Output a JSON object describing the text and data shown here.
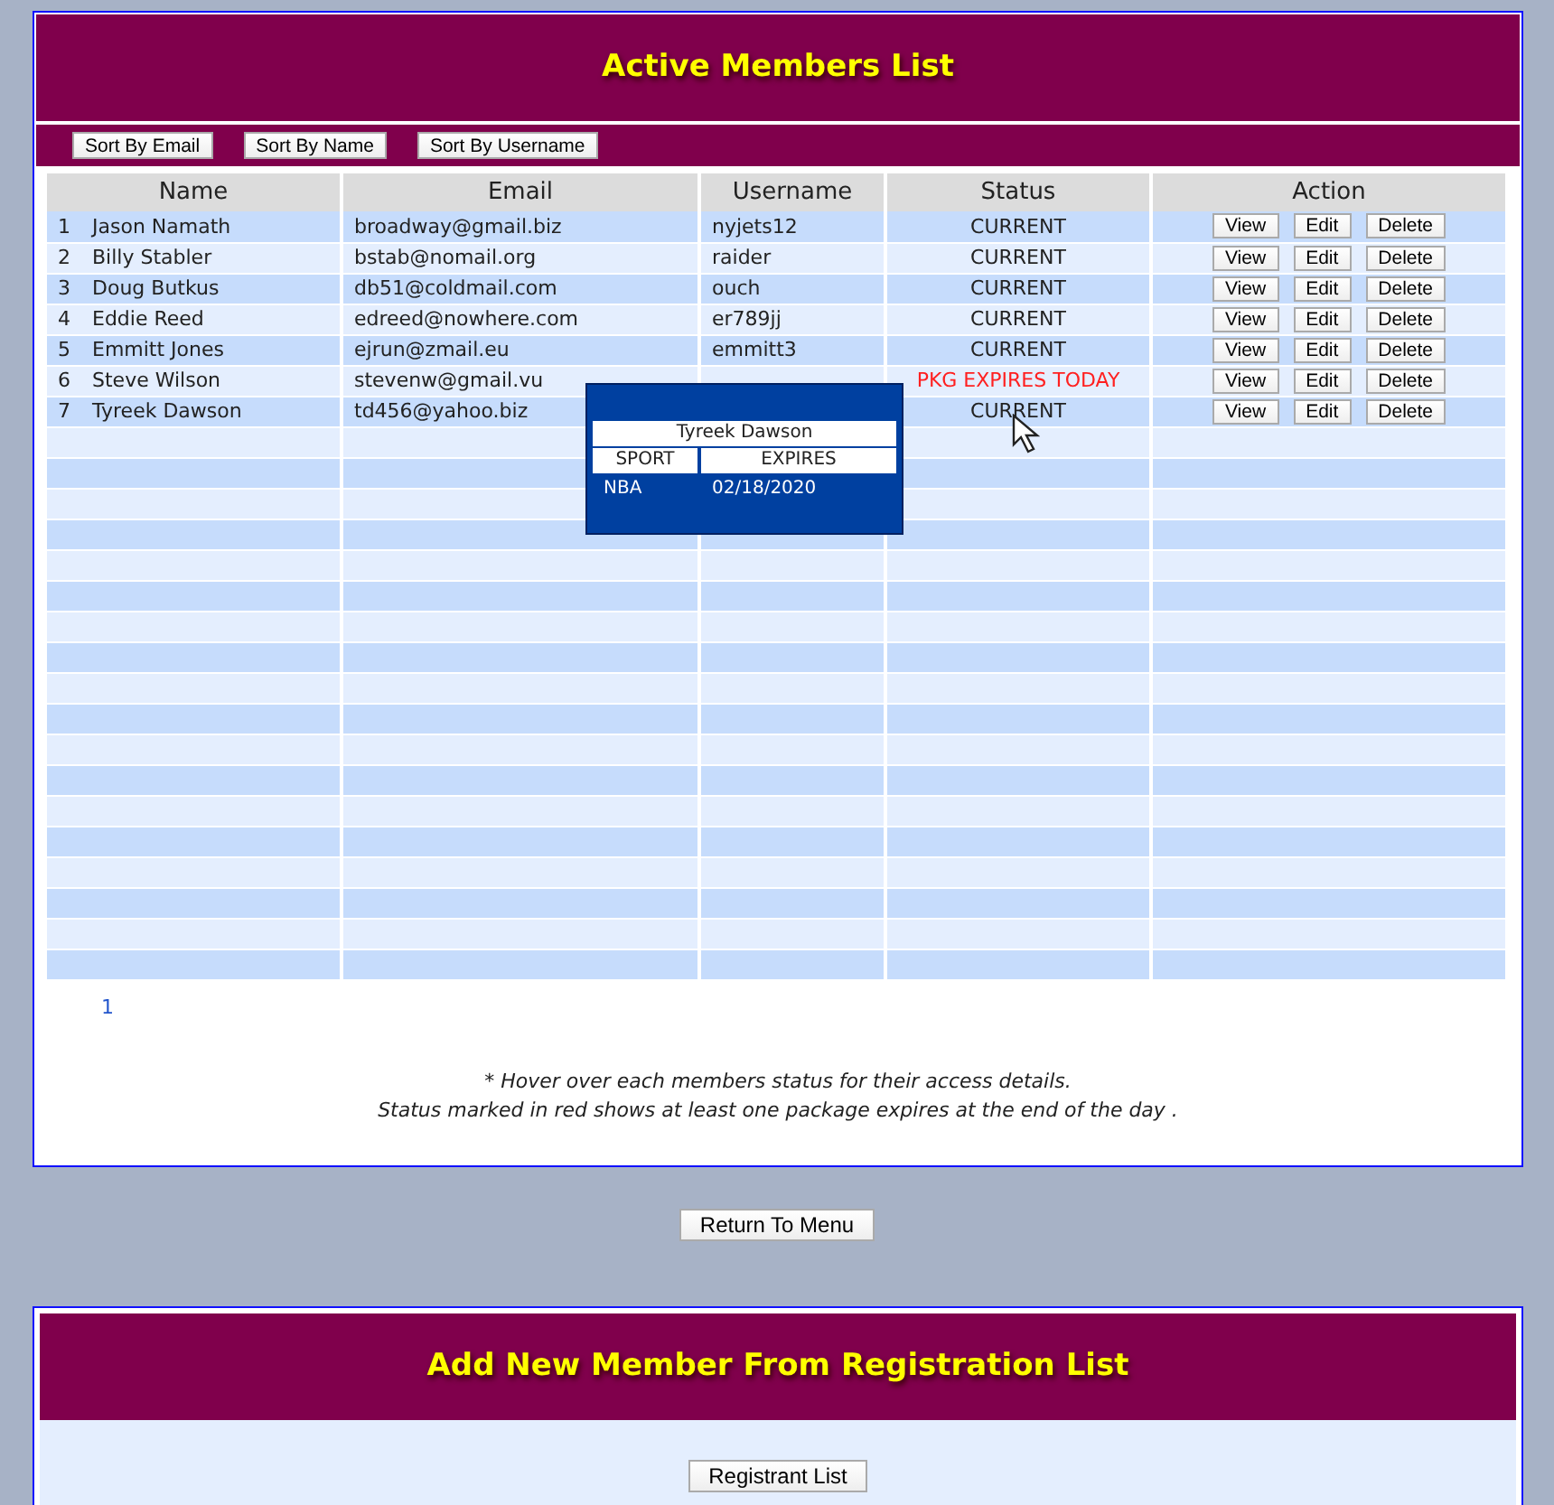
{
  "members_panel": {
    "title": "Active Members List",
    "sort_buttons": [
      "Sort By Email",
      "Sort By Name",
      "Sort By Username"
    ],
    "table": {
      "columns": [
        "Name",
        "Email",
        "Username",
        "Status",
        "Action"
      ],
      "rows": [
        {
          "number": "1",
          "name": "Jason Namath",
          "email": "broadway@gmail.biz",
          "username": "nyjets12",
          "status": "CURRENT",
          "expires_today": false,
          "actions": [
            "View",
            "Edit",
            "Delete"
          ]
        },
        {
          "number": "2",
          "name": "Billy Stabler",
          "email": "bstab@nomail.org",
          "username": "raider",
          "status": "CURRENT",
          "expires_today": false,
          "actions": [
            "View",
            "Edit",
            "Delete"
          ]
        },
        {
          "number": "3",
          "name": "Doug Butkus",
          "email": "db51@coldmail.com",
          "username": "ouch",
          "status": "CURRENT",
          "expires_today": false,
          "actions": [
            "View",
            "Edit",
            "Delete"
          ]
        },
        {
          "number": "4",
          "name": "Eddie Reed",
          "email": "edreed@nowhere.com",
          "username": "er789jj",
          "status": "CURRENT",
          "expires_today": false,
          "actions": [
            "View",
            "Edit",
            "Delete"
          ]
        },
        {
          "number": "5",
          "name": "Emmitt Jones",
          "email": "ejrun@zmail.eu",
          "username": "emmitt3",
          "status": "CURRENT",
          "expires_today": false,
          "actions": [
            "View",
            "Edit",
            "Delete"
          ]
        },
        {
          "number": "6",
          "name": "Steve Wilson",
          "email": "stevenw@gmail.vu",
          "status": "PKG EXPIRES TODAY",
          "expires_today": true,
          "actions": [
            "View",
            "Edit",
            "Delete"
          ]
        },
        {
          "number": "7",
          "name": "Tyreek Dawson",
          "email": "td456@yahoo.biz",
          "status": "CURRENT",
          "expires_today": false,
          "actions": [
            "View",
            "Edit",
            "Delete"
          ]
        }
      ]
    },
    "tooltip": {
      "title": "Tyreek Dawson",
      "columns": [
        "SPORT",
        "EXPIRES"
      ],
      "rows": [
        {
          "sport": "NBA",
          "expires": "02/18/2020"
        }
      ]
    },
    "pages": [
      {
        "label": "1",
        "selected": true
      }
    ],
    "notes": [
      "* Hover over each members status for their access details.",
      "Status marked in red shows at least one package expires at the end of the day ."
    ]
  },
  "return_button": "Return To Menu",
  "add_panel": {
    "title": "Add New Member From Registration List",
    "button": "Registrant List"
  }
}
